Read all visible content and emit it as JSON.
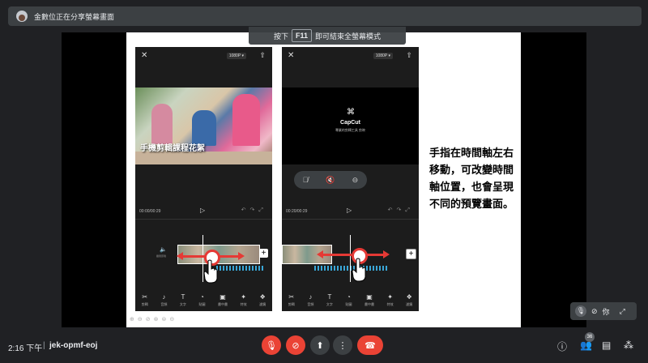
{
  "banner": {
    "text": "金數位正在分享螢幕畫面"
  },
  "hint": {
    "pre": "按下",
    "key": "F11",
    "post": "即可結束全螢幕模式"
  },
  "phone_left": {
    "resolution": "1080P ▾",
    "caption": "手機剪輯課程花絮",
    "time": "00:00/00:29",
    "tools": [
      "剪輯",
      "音頻",
      "文字",
      "貼圖",
      "畫中畫",
      "特效",
      "濾鏡"
    ],
    "clip_label": "關閉原聲"
  },
  "phone_right": {
    "resolution": "1080P ▾",
    "capcut_name": "CapCut",
    "capcut_sub": "專業的剪輯工具 剪映",
    "time": "00:20/00:29",
    "tools": [
      "剪輯",
      "音頻",
      "文字",
      "貼圖",
      "畫中畫",
      "特效",
      "濾鏡"
    ]
  },
  "slide_text": "手指在時間軸左右移動，可改變時間軸位置，也會呈現不同的預覽畫面。",
  "self_view": {
    "label": "你"
  },
  "bottom": {
    "clock": "2:16 下午",
    "separator": "|",
    "meeting_code": "jek-opmf-eoj",
    "people_count": "36"
  },
  "icons": {
    "accent_red": "#ea4335",
    "bar_gray": "#3c4043"
  }
}
